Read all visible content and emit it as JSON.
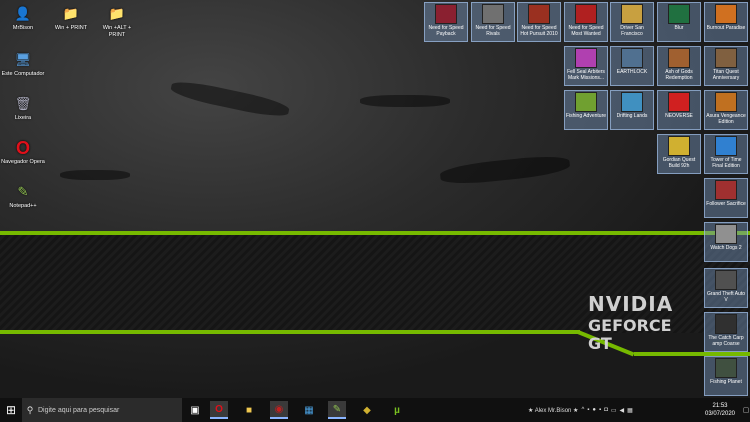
{
  "desktop_icons": [
    {
      "label": "MrBison",
      "icon": "user-folder-icon",
      "color": "#4a7fc0"
    },
    {
      "label": "Win + PRINT",
      "icon": "folder-icon",
      "color": "#f0c850"
    },
    {
      "label": "Win +ALT + PRINT",
      "icon": "folder-icon",
      "color": "#f0c850"
    },
    {
      "label": "Este Computador",
      "icon": "computer-icon",
      "color": "#5aa0e0"
    },
    {
      "label": "Lixeira",
      "icon": "recycle-bin-icon",
      "color": "#9ab"
    },
    {
      "label": "Navegador Opera",
      "icon": "opera-icon",
      "color": "#e0101a"
    },
    {
      "label": "Notepad++",
      "icon": "notepad-plus-plus-icon",
      "color": "#8fc050"
    }
  ],
  "game_shortcuts": [
    {
      "label": "Need for Speed Payback",
      "color": "#8a2030"
    },
    {
      "label": "Need for Speed Rivals",
      "color": "#707070"
    },
    {
      "label": "Need for Speed Hot Pursuit 2010",
      "color": "#9a3020"
    },
    {
      "label": "Need for Speed Most Wanted",
      "color": "#b02020"
    },
    {
      "label": "Driver San Francisco",
      "color": "#c8a040"
    },
    {
      "label": "Blur",
      "color": "#207040"
    },
    {
      "label": "Burnout Paradise",
      "color": "#d07020"
    },
    {
      "label": "Fell Seal Arbiters Mark Missions...",
      "color": "#b040b0"
    },
    {
      "label": "EARTHLOCK",
      "color": "#507090"
    },
    {
      "label": "Ash of Gods Redemption",
      "color": "#a06030"
    },
    {
      "label": "Titan Quest Anniversary",
      "color": "#806040"
    },
    {
      "label": "Fishing Adventure",
      "color": "#70a030"
    },
    {
      "label": "Drifting Lands",
      "color": "#4090c0"
    },
    {
      "label": "NEOVERSE",
      "color": "#d02020"
    },
    {
      "label": "Asura Vengeance Edition",
      "color": "#c07020"
    },
    {
      "label": "Gordian Quest Build 92h",
      "color": "#d0b030"
    },
    {
      "label": "Tower of Time Final Edition",
      "color": "#3080d0"
    },
    {
      "label": "Follower Sacrifice",
      "color": "#a03030"
    },
    {
      "label": "Watch Dogs 2",
      "color": "#909090"
    },
    {
      "label": "Grand Theft Auto V",
      "color": "#505050"
    },
    {
      "label": "The Catch Carp amp Coarse",
      "color": "#303030"
    },
    {
      "label": "Fishing Planet",
      "color": "#405040"
    }
  ],
  "wallpaper": {
    "brand_line1": "NVIDIA",
    "brand_line2": "GEFORCE",
    "brand_line3": "GT",
    "accent": "#76b900"
  },
  "taskbar": {
    "search_placeholder": "Digite aqui para pesquisar",
    "apps": [
      {
        "name": "task-view-icon",
        "glyph": "▣"
      },
      {
        "name": "opera-icon",
        "glyph": "O"
      },
      {
        "name": "file-explorer-icon",
        "glyph": "■"
      },
      {
        "name": "screenshot-tool-icon",
        "glyph": "◉"
      },
      {
        "name": "microsoft-store-icon",
        "glyph": "▦"
      },
      {
        "name": "notepad-plus-plus-icon",
        "glyph": "✎"
      },
      {
        "name": "game-app-icon",
        "glyph": "◆"
      },
      {
        "name": "utorrent-icon",
        "glyph": "µ"
      }
    ],
    "tray_user": "★ Alex Mr.Bison ★",
    "time": "21:53",
    "date": "03/07/2020"
  }
}
